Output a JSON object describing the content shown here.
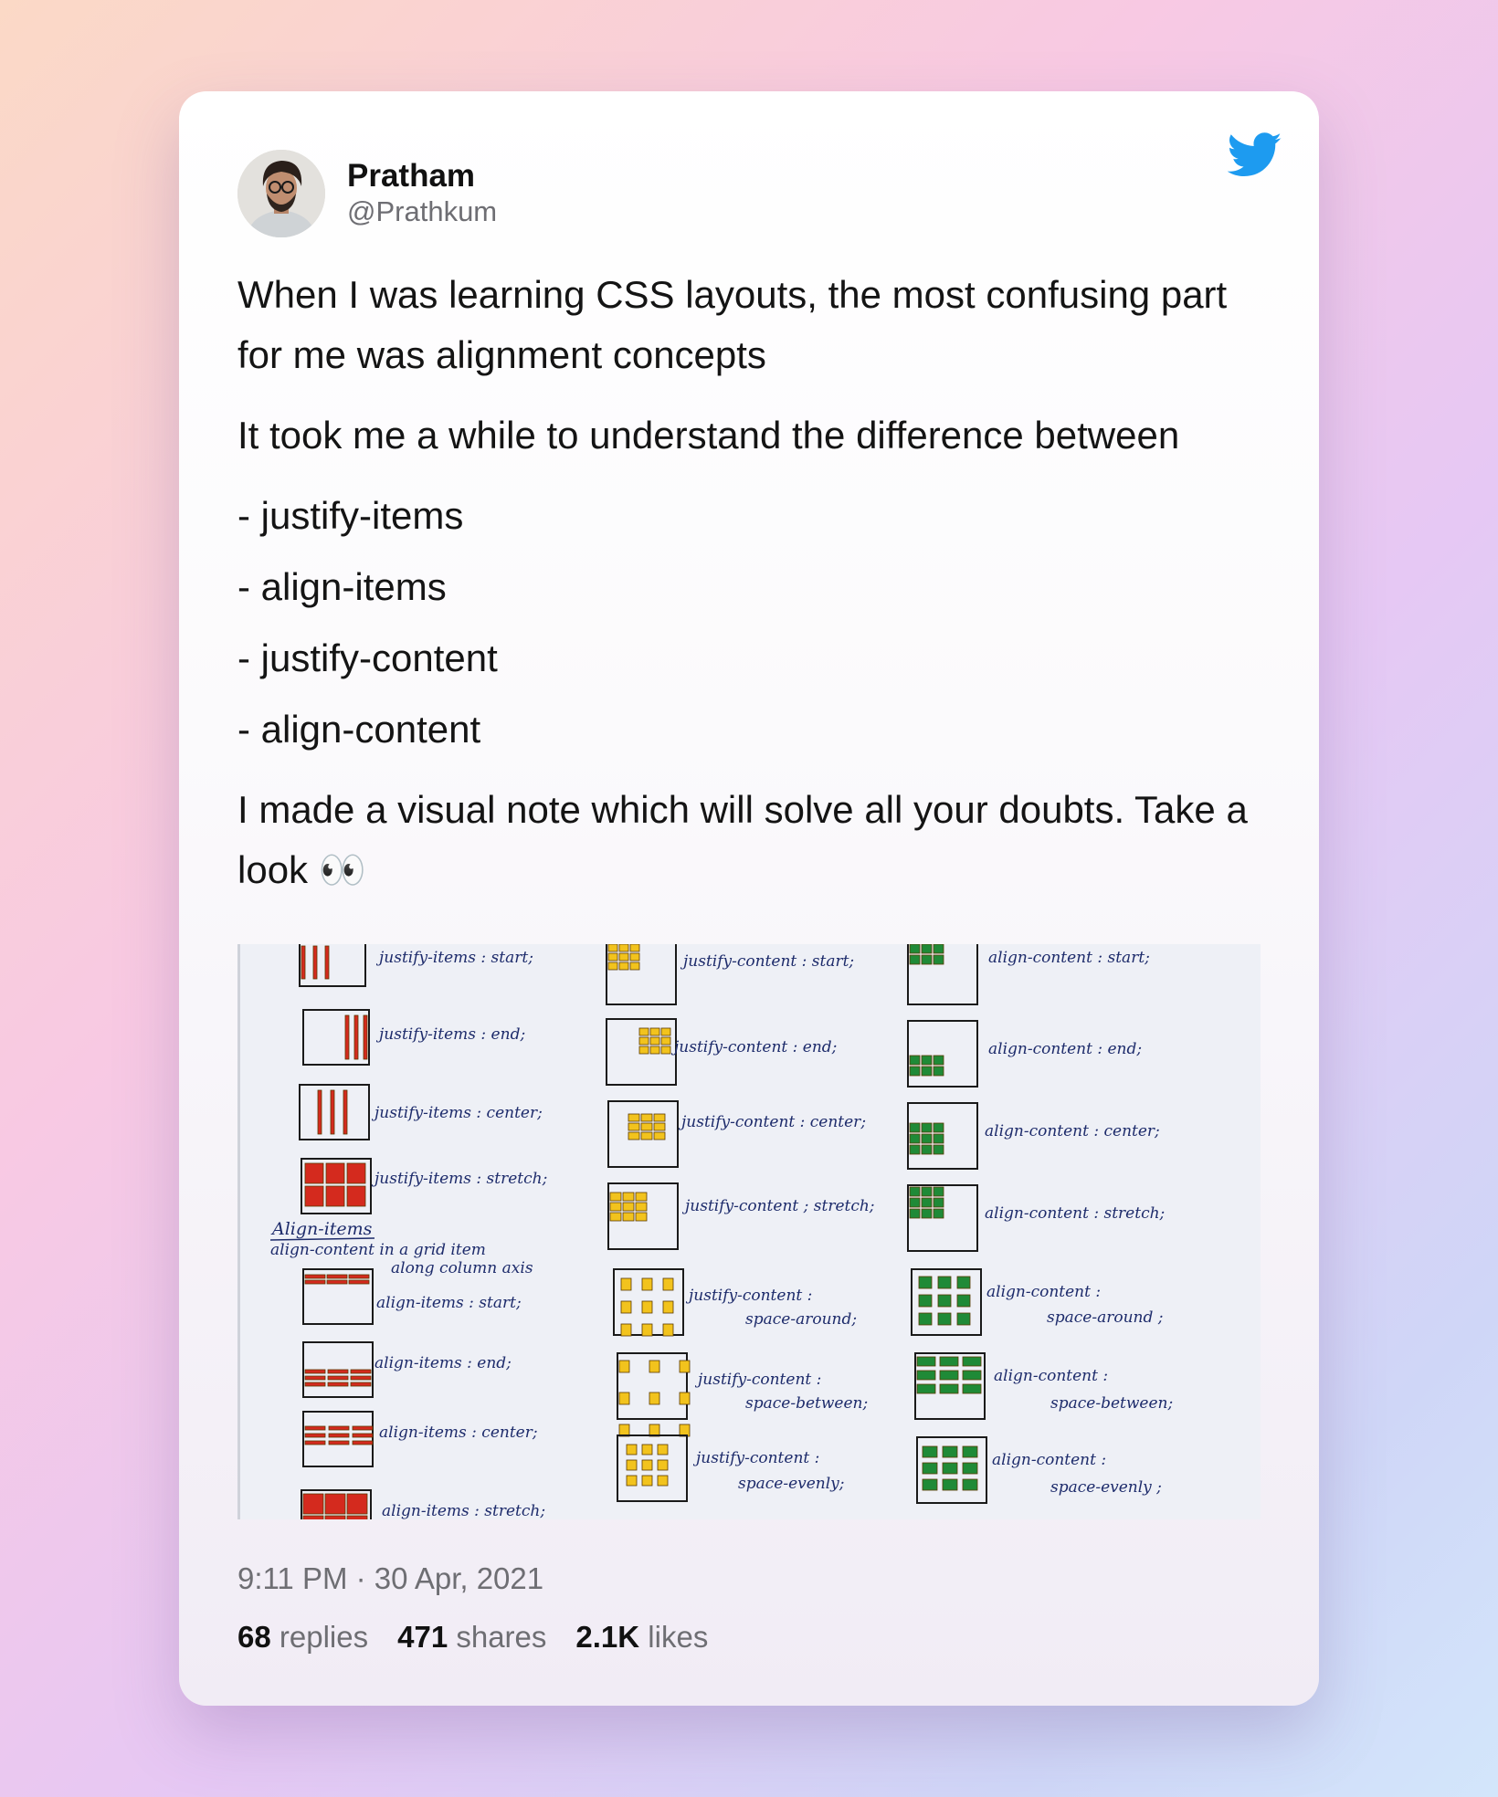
{
  "author": {
    "name": "Pratham",
    "handle": "@Prathkum"
  },
  "tweet": {
    "para1": "When I was learning CSS layouts, the most confusing part for me was alignment concepts",
    "para2": "It took me a while to understand the difference between",
    "bullets": [
      "- justify-items",
      "- align-items",
      "- justify-content",
      "- align-content"
    ],
    "para3": "I made a visual note which will solve all your doubts. Take a look 👀"
  },
  "media": {
    "col1": [
      "justify-items : start;",
      "justify-items : end;",
      "justify-items : center;",
      "justify-items : stretch;",
      "Align-items",
      "align-content in a grid item",
      "along column axis",
      "align-items : start;",
      "align-items : end;",
      "align-items : center;",
      "align-items : stretch;"
    ],
    "col2": [
      "justify-content : start;",
      "justify-content : end;",
      "justify-content : center;",
      "justify-content ; stretch;",
      "justify-content :",
      "space-around;",
      "justify-content :",
      "space-between;",
      "justify-content :",
      "space-evenly;"
    ],
    "col3": [
      "align-content : start;",
      "align-content : end;",
      "align-content : center;",
      "align-content : stretch;",
      "align-content :",
      "space-around ;",
      "align-content :",
      "space-between;",
      "align-content :",
      "space-evenly ;"
    ]
  },
  "meta": {
    "timestamp": "9:11 PM · 30 Apr, 2021",
    "replies_count": "68",
    "replies_label": "replies",
    "shares_count": "471",
    "shares_label": "shares",
    "likes_count": "2.1K",
    "likes_label": "likes"
  },
  "colors": {
    "twitter_blue": "#1d9bf0",
    "red": "#d42a1e",
    "yellow": "#f2c31d",
    "green": "#1f8a37",
    "ink": "#1d2b6b"
  }
}
